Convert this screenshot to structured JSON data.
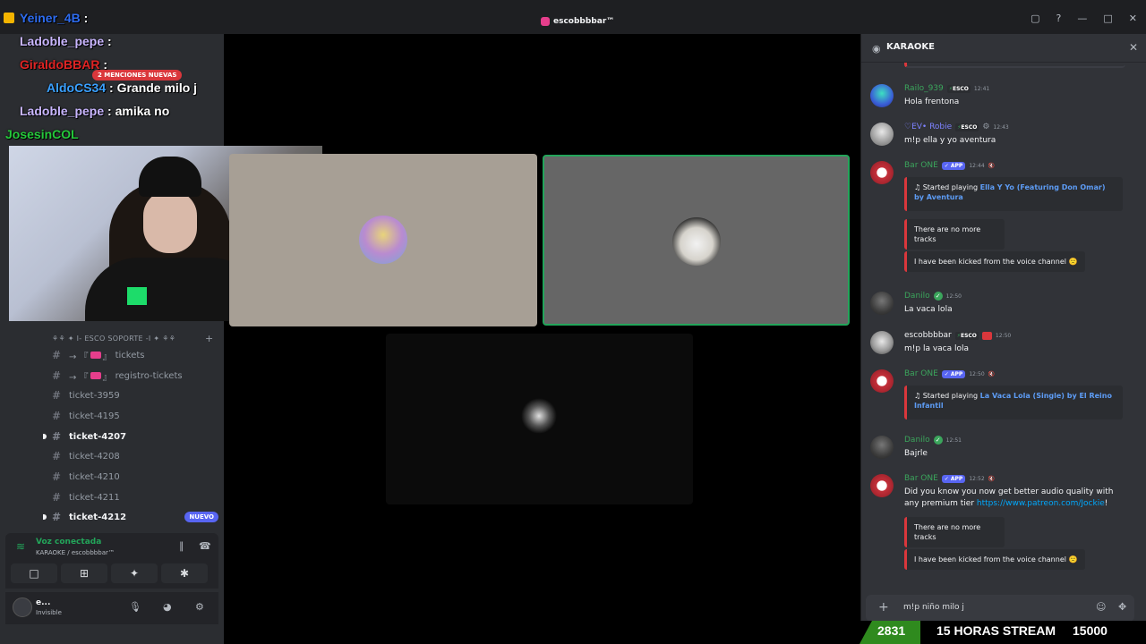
{
  "window": {
    "title": "escobbbbar™"
  },
  "overlay": {
    "lines": [
      {
        "user": "Yeiner_4B",
        "sep": " :",
        "message": "",
        "color": "#2e6cf0"
      },
      {
        "user": "Ladoble_pepe",
        "sep": " :",
        "message": "",
        "color": "#c9b6ff"
      },
      {
        "user": "GiraldoBBAR",
        "sep": " :",
        "message": "",
        "color": "#e02424"
      },
      {
        "user": "AldoCS34",
        "sep": " :",
        "message": "Grande milo j",
        "color": "#3aa0ff"
      },
      {
        "user": "Ladoble_pepe",
        "sep": " :",
        "message": "amika no",
        "color": "#c9b6ff"
      },
      {
        "user": "JosesinCOL",
        "sep": "",
        "message": "",
        "color": "#25c93b"
      }
    ]
  },
  "sidebar": {
    "mentions_badge": "2 MENCIONES NUEVAS",
    "category": "⚘⚘ ✦ I- ESCO SOPORTE -I ✦ ⚘⚘",
    "channels": [
      {
        "name": "tickets",
        "prefix": "→ 『",
        "suffix": "』",
        "unread": false
      },
      {
        "name": "registro-tickets",
        "prefix": "→ 『",
        "suffix": "』",
        "unread": false
      },
      {
        "name": "ticket-3959",
        "unread": false
      },
      {
        "name": "ticket-4195",
        "unread": false
      },
      {
        "name": "ticket-4207",
        "unread": true
      },
      {
        "name": "ticket-4208",
        "unread": false
      },
      {
        "name": "ticket-4210",
        "unread": false
      },
      {
        "name": "ticket-4211",
        "unread": false
      },
      {
        "name": "ticket-4212",
        "unread": true,
        "badge": "NUEVO"
      }
    ]
  },
  "voice": {
    "status": "Voz conectada",
    "channel": "KARAOKE / escobbbbar™"
  },
  "user": {
    "name": "e...",
    "status": "Invisible"
  },
  "chat": {
    "title": "KARAOKE",
    "input_value": "m!p niño milo j",
    "messages": [
      {
        "id": "railo",
        "name": "Railo_939",
        "tag": "ESCO",
        "time": "12:41",
        "text": "Hola frentona"
      },
      {
        "id": "robie",
        "name": "♡EV• Robie",
        "tag": "ESCO",
        "time": "12:43",
        "text": "m!p ella y yo aventura"
      },
      {
        "id": "bar1",
        "name": "Bar ONE",
        "tag": "APP",
        "time": "12:44",
        "embed_prefix": "Started playing ",
        "embed_link": "Ella Y Yo (Featuring Don Omar) by Aventura",
        "notice1": "There are no more tracks",
        "notice2": "I have been kicked from the voice channel 🙁"
      },
      {
        "id": "danilo1",
        "name": "Danilo",
        "time": "12:50",
        "text": "La vaca lola"
      },
      {
        "id": "esco",
        "name": "escobbbbar",
        "tag": "ESCO",
        "time": "12:50",
        "text": "m!p la vaca lola"
      },
      {
        "id": "bar2",
        "name": "Bar ONE",
        "tag": "APP",
        "time": "12:50",
        "embed_prefix": "Started playing ",
        "embed_link": "La Vaca Lola (Single) by El Reino Infantil"
      },
      {
        "id": "danilo2",
        "name": "Danilo",
        "time": "12:51",
        "text": "Bajrle"
      },
      {
        "id": "bar3",
        "name": "Bar ONE",
        "tag": "APP",
        "time": "12:52",
        "text": "Did you know you now get better audio quality with any premium tier ",
        "link": "https://www.patreon.com/Jockie",
        "link_suffix": "!",
        "notice1": "There are no more tracks",
        "notice2": "I have been kicked from the voice channel 🙁"
      }
    ]
  },
  "counter": {
    "left": "2831",
    "label": "15 HORAS STREAM",
    "right": "15000"
  },
  "colors": {
    "accent": "#5865f2",
    "online": "#23a55a",
    "danger": "#da373c"
  }
}
